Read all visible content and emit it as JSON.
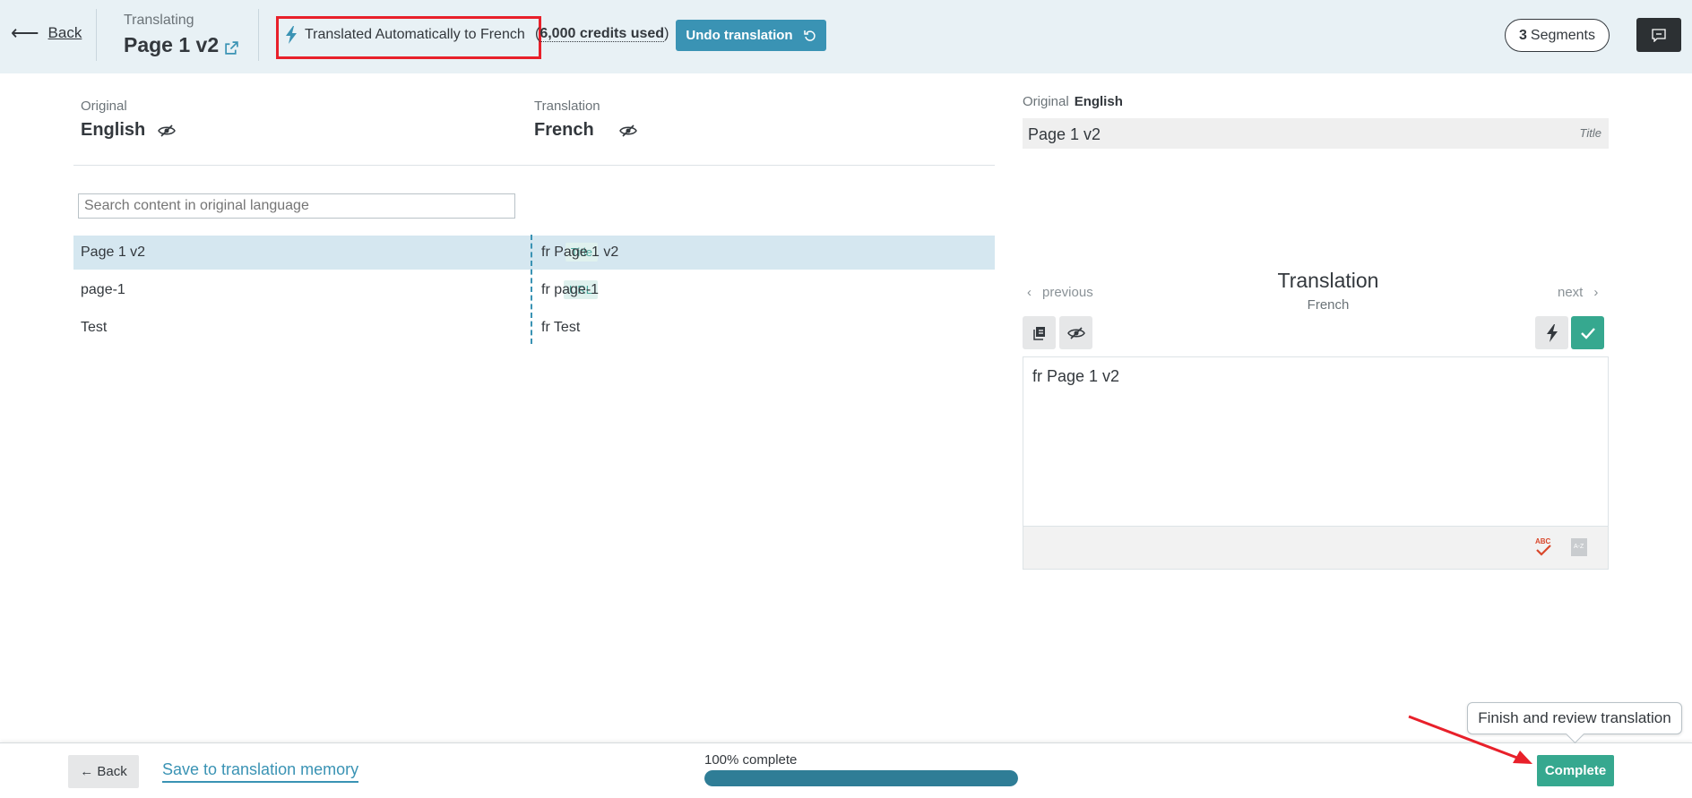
{
  "header": {
    "back_label": "Back",
    "translating_label": "Translating",
    "page_title": "Page 1 v2",
    "auto_translated_text": "Translated Automatically to French",
    "credits_open": "(",
    "credits_text": "6,000 credits used",
    "credits_close": ")",
    "undo_label": "Undo translation",
    "segments_count": "3",
    "segments_label": "Segments"
  },
  "left": {
    "original_label": "Original",
    "original_lang": "English",
    "translation_label": "Translation",
    "translation_lang": "French",
    "search_placeholder": "Search content in original language",
    "segments": [
      {
        "original": "Page 1 v2",
        "tag": "Title",
        "translation": "fr Page 1 v2"
      },
      {
        "original": "page-1",
        "tag": "URL",
        "translation": "fr page-1"
      },
      {
        "original": "Test",
        "tag": "",
        "translation": "fr Test"
      }
    ]
  },
  "right": {
    "original_label": "Original",
    "original_lang": "English",
    "original_text": "Page 1 v2",
    "original_tag": "Title",
    "previous_label": "previous",
    "next_label": "next",
    "translation_title": "Translation",
    "translation_lang": "French",
    "editor_text": "fr Page 1 v2"
  },
  "footer": {
    "back_label": "← Back",
    "save_tm_label": "Save to translation memory",
    "progress_label": "100% complete",
    "progress_fraction": 1.0,
    "complete_label": "Complete",
    "tooltip_text": "Finish and review translation"
  },
  "colors": {
    "accent": "#3a93b4",
    "success": "#36a88f",
    "highlight_box": "#e8202a",
    "header_bg": "#e8f1f5"
  }
}
